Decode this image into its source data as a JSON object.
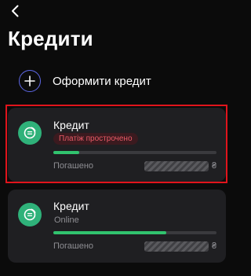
{
  "header": {
    "title": "Кредити"
  },
  "apply": {
    "label": "Оформити кредит"
  },
  "loans": [
    {
      "title": "Кредит",
      "status_badge": "Платіж прострочено",
      "progress": 0.16,
      "paid_label": "Погашено",
      "currency": "₴"
    },
    {
      "title": "Кредит",
      "subtitle": "Online",
      "progress": 0.69,
      "paid_label": "Погашено",
      "currency": "₴"
    }
  ],
  "colors": {
    "background": "#0b0b0b",
    "card": "#1f1f22",
    "accent_green": "#31c36e",
    "coin_green": "#2fb27a",
    "overdue_text": "#e85a66",
    "overdue_bg": "#3b1a1f",
    "plus_ring": "#5e68e6",
    "highlight_border": "#e0141c"
  },
  "icons": {
    "back": "chevron-left-icon",
    "add": "plus-icon",
    "loan": "coin-icon"
  }
}
